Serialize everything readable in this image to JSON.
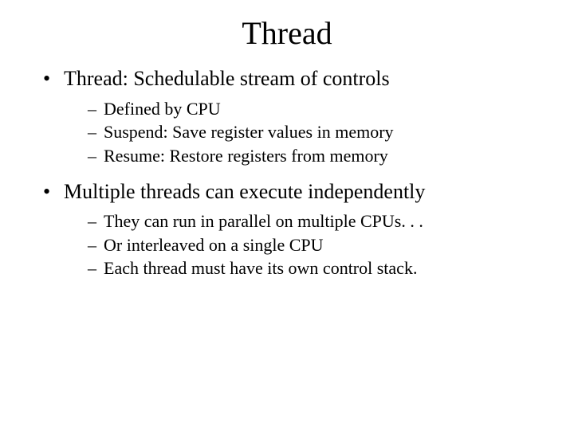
{
  "slide": {
    "title": "Thread",
    "bullets": [
      {
        "text": "Thread:  Schedulable stream of controls",
        "sub": [
          "Defined by CPU",
          "Suspend: Save register values in memory",
          "Resume: Restore registers from memory"
        ]
      },
      {
        "text": "Multiple threads can execute independently",
        "sub": [
          "They can run in parallel on multiple CPUs. . .",
          "Or interleaved on a single CPU",
          "Each thread must have its own control stack."
        ]
      }
    ]
  }
}
